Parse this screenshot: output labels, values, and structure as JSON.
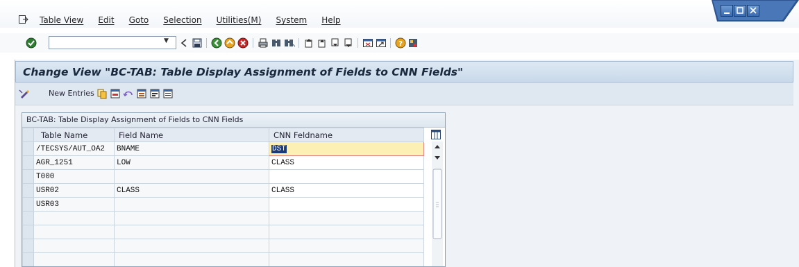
{
  "menu": {
    "items": [
      "Table View",
      "Edit",
      "Goto",
      "Selection",
      "Utilities(M)",
      "System",
      "Help"
    ]
  },
  "toolbar": {
    "command_value": "",
    "icons": [
      "enter-icon",
      "back-icon",
      "save-icon",
      "back-green-icon",
      "exit-icon",
      "cancel-icon",
      "print-icon",
      "find-icon",
      "find-next-icon",
      "first-page-icon",
      "prev-page-icon",
      "next-page-icon",
      "last-page-icon",
      "create-session-icon",
      "shortcut-icon",
      "help-icon",
      "layout-icon"
    ]
  },
  "page": {
    "title": "Change View \"BC-TAB: Table Display Assignment of Fields to CNN Fields\""
  },
  "app_toolbar": {
    "new_entries_label": "New Entries"
  },
  "table": {
    "title": "BC-TAB: Table Display Assignment of Fields to CNN Fields",
    "columns": [
      "Table Name",
      "Field Name",
      "CNN Feldname"
    ],
    "rows": [
      [
        "/TECSYS/AUT_OA2",
        "BNAME",
        "DST"
      ],
      [
        "AGR_1251",
        "LOW",
        "CLASS"
      ],
      [
        "T000",
        "",
        ""
      ],
      [
        "USR02",
        "CLASS",
        "CLASS"
      ],
      [
        "USR03",
        "",
        ""
      ],
      [
        "",
        "",
        ""
      ],
      [
        "",
        "",
        ""
      ],
      [
        "",
        "",
        ""
      ],
      [
        "",
        "",
        ""
      ]
    ]
  },
  "colors": {
    "title_band": "#c9d9ea",
    "active_cell": "#fdf0b5",
    "selection_highlight": "#1b3a7a"
  }
}
